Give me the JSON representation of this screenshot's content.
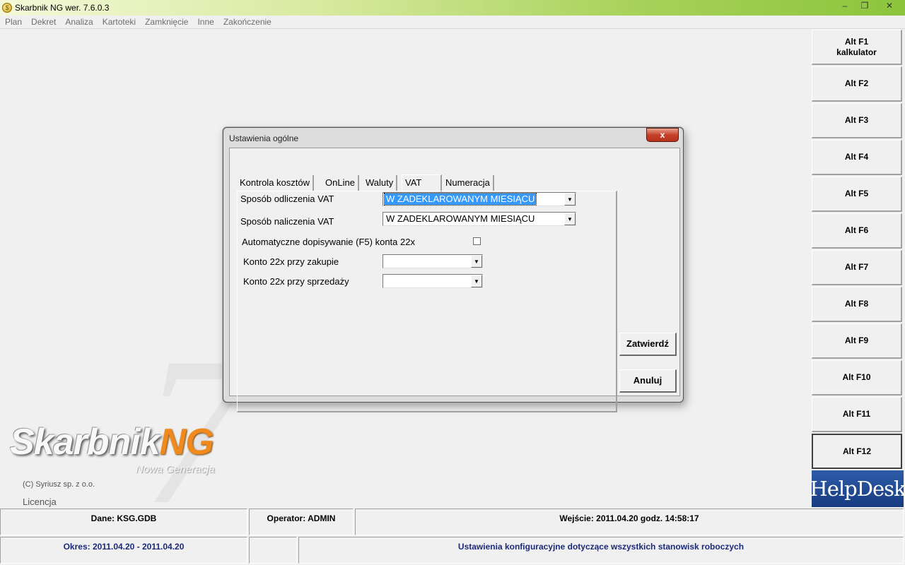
{
  "window": {
    "title": "Skarbnik NG wer. 7.6.0.3",
    "minimize": "–",
    "restore": "❐",
    "close": "✕"
  },
  "menu": [
    "Plan",
    "Dekret",
    "Analiza",
    "Kartoteki",
    "Zamknięcie",
    "Inne",
    "Zakończenie"
  ],
  "function_keys": [
    [
      "Alt F1",
      "kalkulator"
    ],
    [
      "Alt F2"
    ],
    [
      "Alt F3"
    ],
    [
      "Alt F4"
    ],
    [
      "Alt F5"
    ],
    [
      "Alt F6"
    ],
    [
      "Alt F7"
    ],
    [
      "Alt F8"
    ],
    [
      "Alt F9"
    ],
    [
      "Alt F10"
    ],
    [
      "Alt F11"
    ],
    [
      "Alt F12"
    ]
  ],
  "helpdesk": "HelpDesk",
  "logo": {
    "main": "Skarbnik",
    "ng": "NG",
    "sub": "Nowa Generacja",
    "seven": "7"
  },
  "copyright": "(C) Syriusz sp. z o.o.",
  "licencja": "Licencja",
  "status": {
    "dane": "Dane: KSG.GDB",
    "operator": "Operator: ADMIN",
    "wejscie": "Wejście: 2011.04.20 godz. 14:58:17",
    "okres": "Okres: 2011.04.20 - 2011.04.20",
    "info": "Ustawienia konfiguracyjne dotyczące wszystkich stanowisk roboczych"
  },
  "dialog": {
    "title": "Ustawienia ogólne",
    "close": "x",
    "tabs": [
      "Kontrola kosztów",
      "OnLine",
      "Waluty",
      "VAT",
      "Numeracja"
    ],
    "active_tab": "VAT",
    "fields": {
      "odliczenie_label": "Sposób odliczenia VAT",
      "odliczenie_value": "W ZADEKLAROWANYM MIESIĄCU",
      "naliczenie_label": "Sposób naliczenia VAT",
      "naliczenie_value": "W ZADEKLAROWANYM MIESIĄCU",
      "auto_label": "Automatyczne dopisywanie (F5)  konta 22x",
      "auto_checked": false,
      "zakup_label": "Konto 22x przy zakupie",
      "zakup_value": "",
      "sprzedaz_label": "Konto 22x przy sprzedaży",
      "sprzedaz_value": ""
    },
    "buttons": {
      "confirm": "Zatwierdź",
      "cancel": "Anuluj"
    }
  }
}
